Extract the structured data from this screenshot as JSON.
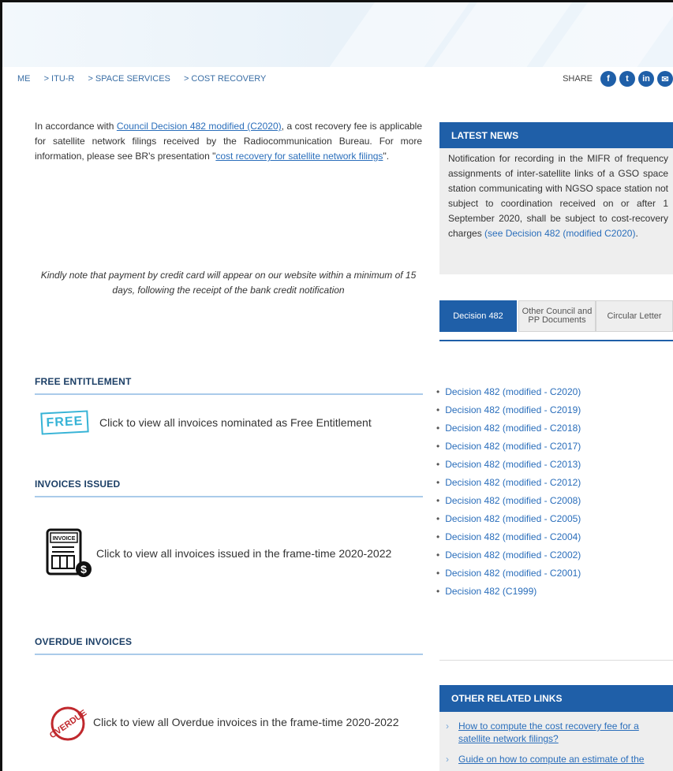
{
  "breadcrumb": [
    "ME",
    "> ITU-R",
    "> SPACE SERVICES",
    "> COST RECOVERY"
  ],
  "share": {
    "label": "SHARE",
    "icons": [
      "f",
      "t",
      "in",
      "✉"
    ]
  },
  "intro": {
    "before": "In accordance with ",
    "link1": "Council Decision 482 modified (C2020)",
    "middle": ", a cost recovery fee is applicable for satellite network filings received by the Radiocommunication Bureau. For more information, please see BR's presentation \"",
    "link2": "cost recovery for satellite network filings",
    "after": "\"."
  },
  "note": "Kindly note that payment by credit card will appear on our website within a minimum of 15 days, following the receipt of the bank credit notification",
  "free": {
    "title": "FREE ENTITLEMENT",
    "icon_text": "FREE",
    "text": "Click to view all invoices nominated as Free Entitlement"
  },
  "invoices": {
    "title": "INVOICES ISSUED",
    "icon_text": "INVOICE",
    "text": "Click to view all invoices issued in the frame-time 2020-2022"
  },
  "overdue": {
    "title": "OVERDUE INVOICES",
    "icon_text": "OVERDUE",
    "text": "Click to view all Overdue invoices in the frame-time 2020-2022"
  },
  "latest_news": {
    "title": "LATEST NEWS",
    "text": "Notification for recording in the MIFR of frequency assignments of inter-satellite links of a GSO space station communicating with NGSO space station not subject to coordination received on or after 1 September 2020, shall be subject to cost-recovery charges ",
    "link": "(see Decision 482 (modified C2020)",
    "end": "."
  },
  "tabs": [
    "Decision 482",
    "Other Council and PP Documents",
    "Circular Letter"
  ],
  "decisions": [
    "Decision 482 (modified - C2020)",
    "Decision 482 (modified - C2019)",
    "Decision 482 (modified - C2018)",
    "Decision 482 (modified - C2017)",
    "Decision 482 (modified - C2013)",
    "Decision 482 (modified - C2012)",
    "Decision 482 (modified - C2008)",
    "Decision 482 (modified - C2005)",
    "Decision 482 (modified - C2004)",
    "Decision 482 (modified - C2002)",
    "Decision 482 (modified - C2001)",
    "Decision 482 (C1999)"
  ],
  "related": {
    "title": "OTHER RELATED LINKS",
    "links": [
      "How to compute the cost recovery fee for a satellite network filings?",
      "Guide on how to compute an estimate of the"
    ]
  },
  "colors": {
    "primary": "#1f5fa8",
    "link": "#2a6ebb",
    "panel": "#eeeeee",
    "free": "#36b3d6",
    "overdue": "#c0282d"
  }
}
